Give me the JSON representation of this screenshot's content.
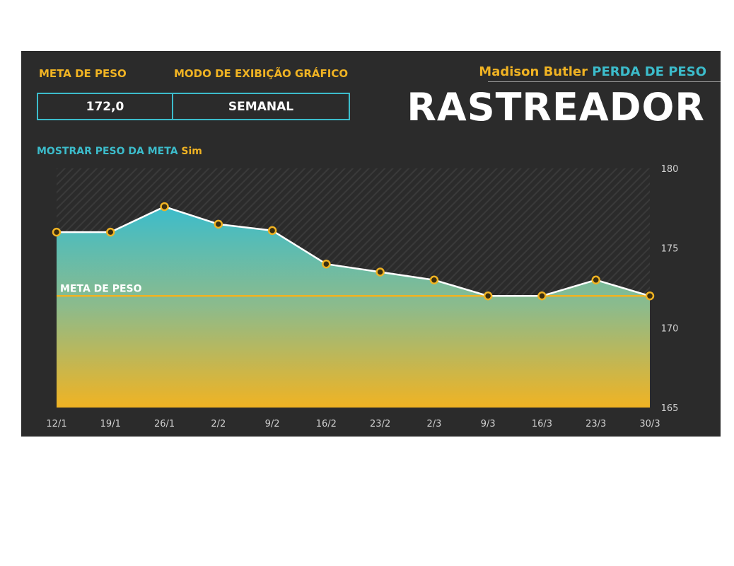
{
  "header": {
    "meta_label": "META DE PESO",
    "modo_label": "MODO DE EXIBIÇÃO GRÁFICO",
    "name": "Madison Butler",
    "subtitle": "PERDA DE PESO",
    "title": "RASTREADOR",
    "meta_value": "172,0",
    "modo_value": "SEMANAL",
    "mostrar_label": "MOSTRAR PESO DA META",
    "mostrar_value": "Sim"
  },
  "colors": {
    "background": "#2b2b2b",
    "accent_gold": "#f0b323",
    "accent_teal": "#3cbccb",
    "line": "#ffffff"
  },
  "chart_data": {
    "type": "area",
    "categories": [
      "12/1",
      "19/1",
      "26/1",
      "2/2",
      "9/2",
      "16/2",
      "23/2",
      "2/3",
      "9/3",
      "16/3",
      "23/3",
      "30/3"
    ],
    "values": [
      176.0,
      176.0,
      177.6,
      176.5,
      176.1,
      174.0,
      173.5,
      173.0,
      172.0,
      172.0,
      173.0,
      172.0
    ],
    "goal": 172.0,
    "goal_label": "META DE PESO",
    "ylim": [
      165,
      180
    ],
    "yticks": [
      "165",
      "170",
      "175",
      "180"
    ],
    "y_axis_side": "right",
    "title": "",
    "xlabel": "",
    "ylabel": ""
  }
}
